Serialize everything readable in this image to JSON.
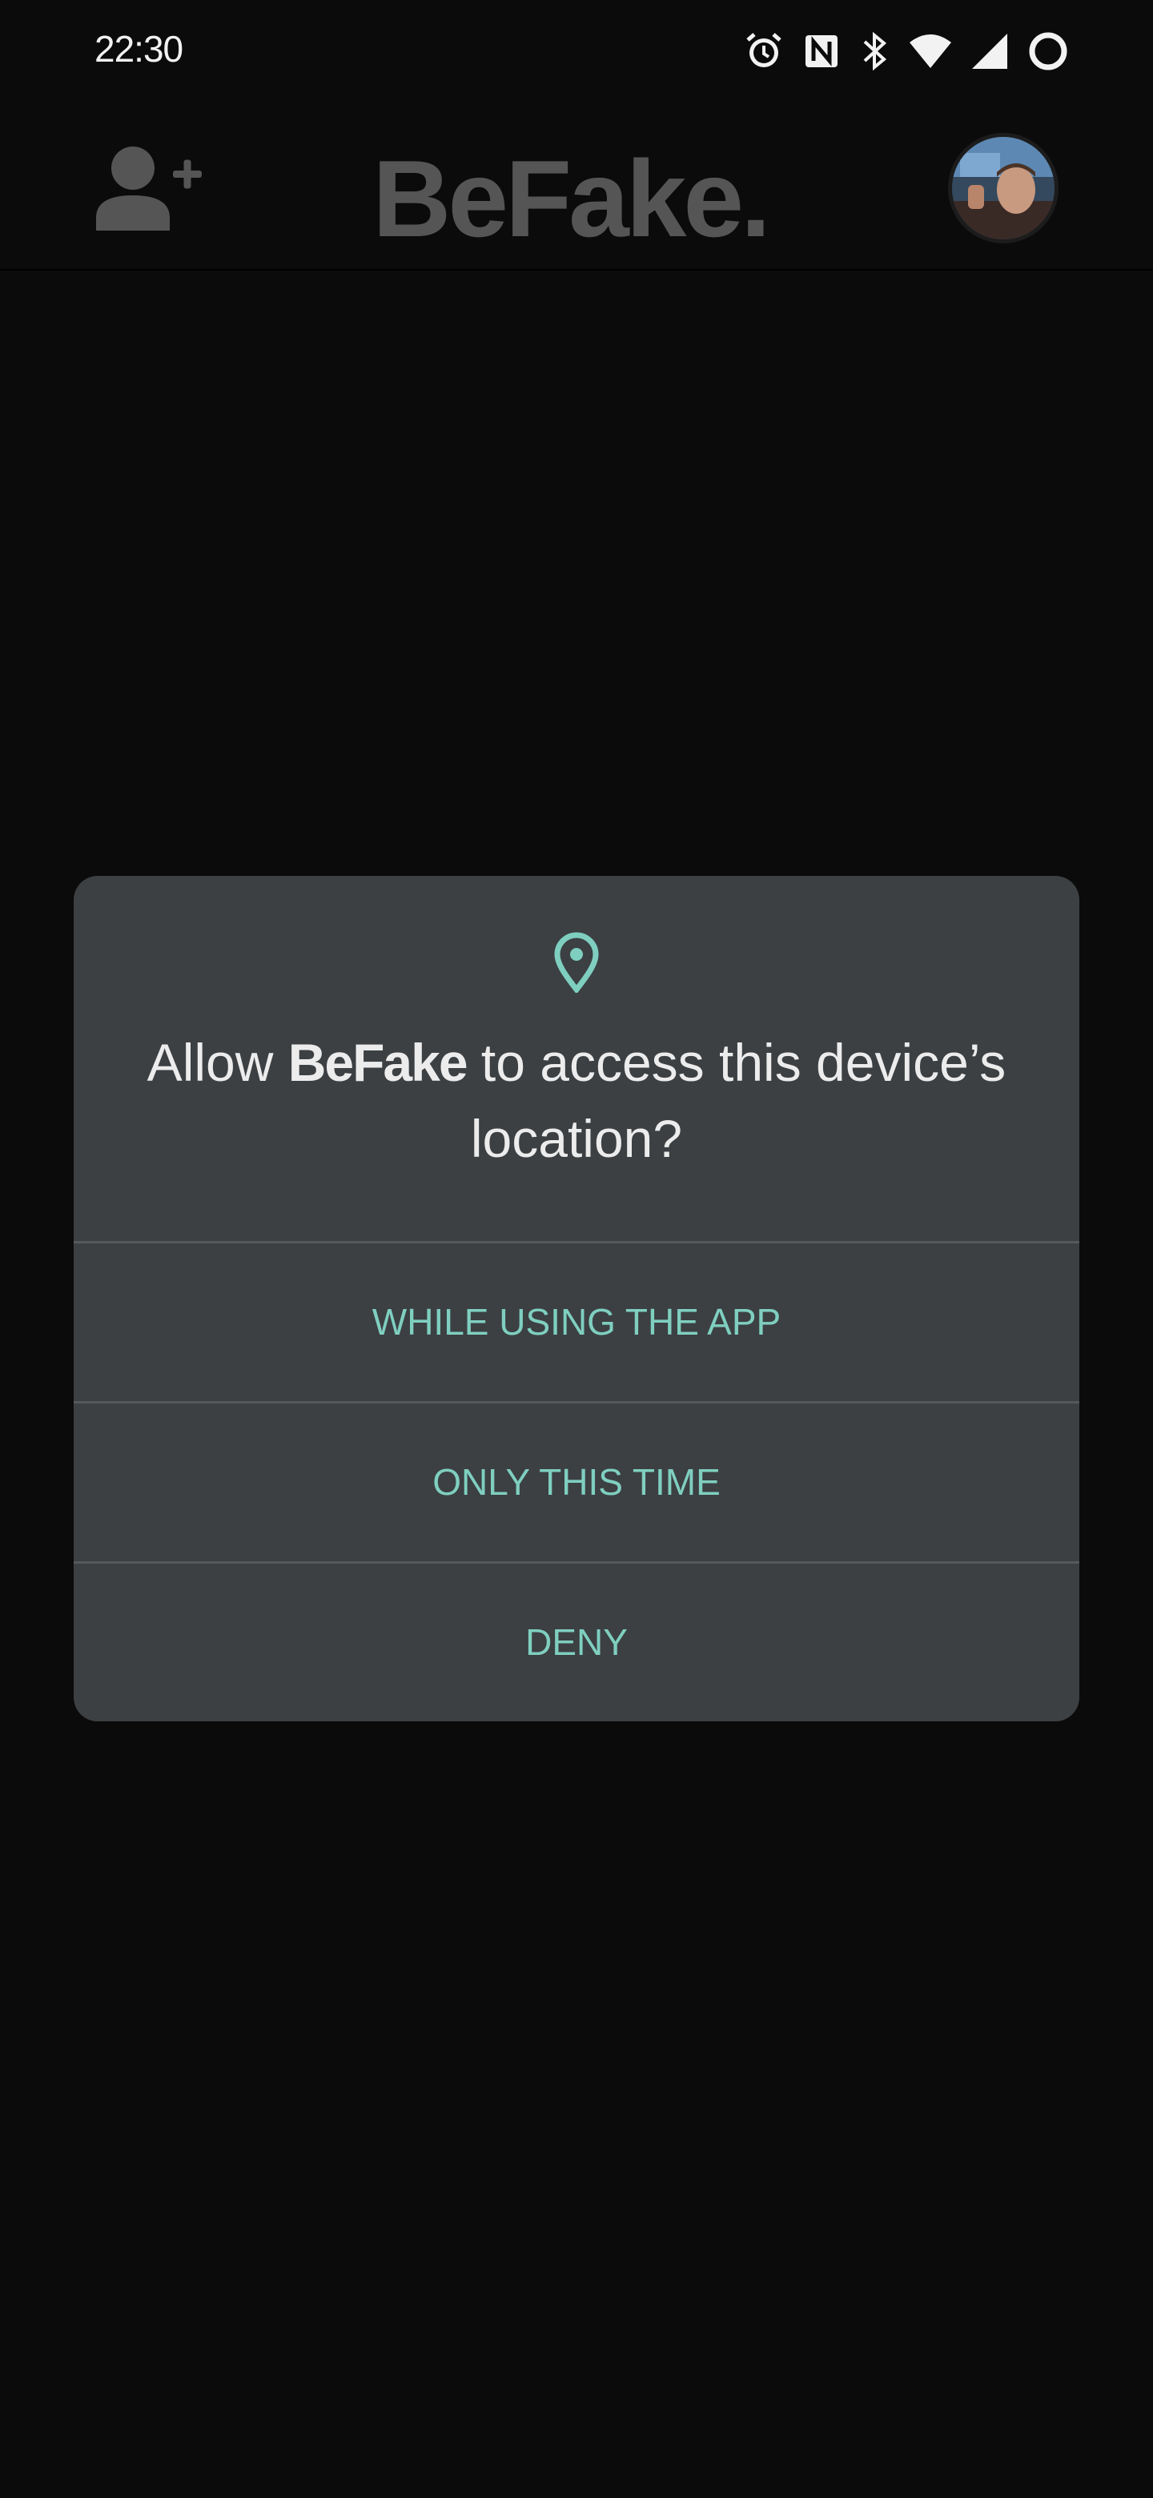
{
  "status_bar": {
    "time": "22:30",
    "icons": [
      "alarm-icon",
      "nfc-icon",
      "bluetooth-icon",
      "wifi-icon",
      "cell-signal-icon",
      "battery-ring-icon"
    ]
  },
  "header": {
    "logo": "BeFake.",
    "add_friend_icon": "add-person-icon",
    "avatar_icon": "profile-avatar"
  },
  "dialog": {
    "icon": "location-pin-icon",
    "title_prefix": "Allow ",
    "app_name": "BeFake",
    "title_suffix": " to access this device’s location?",
    "buttons": [
      {
        "label": "WHILE USING THE APP"
      },
      {
        "label": "ONLY THIS TIME"
      },
      {
        "label": "DENY"
      }
    ]
  },
  "colors": {
    "background": "#0b0b0b",
    "dialog": "#3c4043",
    "accent": "#7fcfc0",
    "logo": "#555555"
  }
}
